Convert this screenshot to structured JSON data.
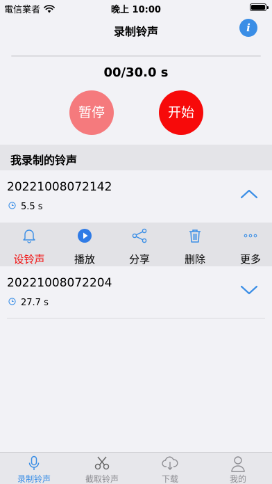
{
  "status_bar": {
    "carrier": "電信業者",
    "time": "晚上 10:00"
  },
  "nav": {
    "title": "录制铃声",
    "info_icon": "info-icon"
  },
  "recorder": {
    "progress": 0.0,
    "timer": "00/30.0 s",
    "pause_label": "暂停",
    "start_label": "开始"
  },
  "section": {
    "title": "我录制的铃声"
  },
  "recordings": [
    {
      "name": "20221008072142",
      "duration": "5.5 s",
      "expanded": true
    },
    {
      "name": "20221008072204",
      "duration": "27.7 s",
      "expanded": false
    }
  ],
  "actions": [
    {
      "label": "设铃声",
      "icon": "bell-icon",
      "selected": true
    },
    {
      "label": "播放",
      "icon": "play-icon"
    },
    {
      "label": "分享",
      "icon": "share-icon"
    },
    {
      "label": "删除",
      "icon": "trash-icon"
    },
    {
      "label": "更多",
      "icon": "more-icon"
    }
  ],
  "tabs": [
    {
      "label": "录制铃声",
      "icon": "microphone-icon",
      "active": true
    },
    {
      "label": "截取铃声",
      "icon": "scissors-icon"
    },
    {
      "label": "下载",
      "icon": "cloud-download-icon"
    },
    {
      "label": "我的",
      "icon": "person-icon"
    }
  ],
  "colors": {
    "accent": "#3a8ee6",
    "start_red": "#f70a0a",
    "pause_pink": "#f57a7d",
    "selected_red": "#f20d0d"
  }
}
